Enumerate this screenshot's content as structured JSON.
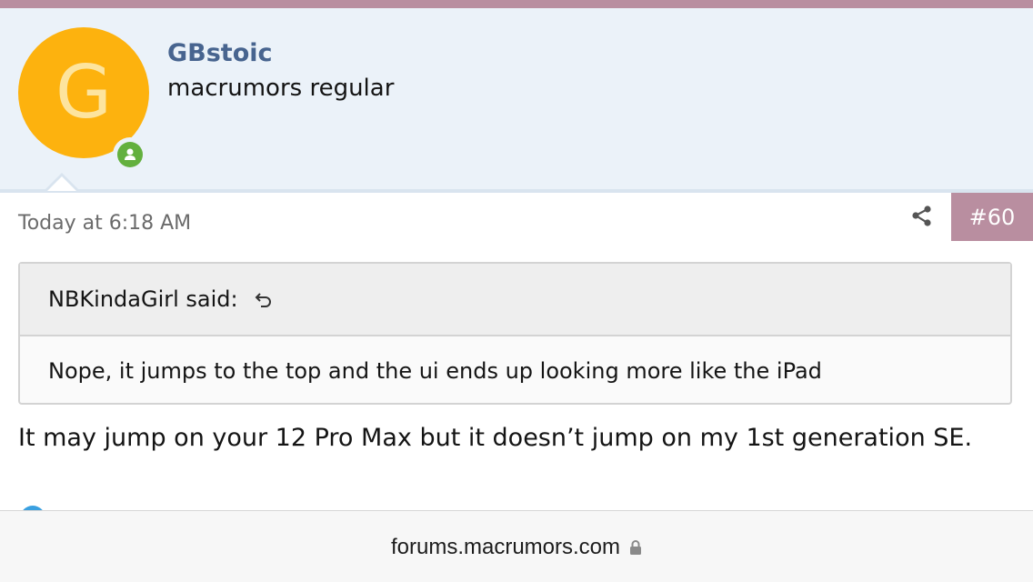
{
  "user": {
    "avatar_letter": "G",
    "name": "GBstoic",
    "title": "macrumors regular",
    "avatar_color": "#fdb20e",
    "online_color": "#63b03e"
  },
  "post": {
    "date": "Today at 6:18 AM",
    "number": "#60",
    "quote": {
      "author_line": "NBKindaGirl said:",
      "text": "Nope, it jumps to the top and the ui ends up looking more like the iPad"
    },
    "body": "It may jump on your 12 Pro Max but it doesn’t jump on my 1st generation SE."
  },
  "browser": {
    "url": "forums.macrumors.com"
  },
  "icons": {
    "online": "user-online-icon",
    "share": "share-icon",
    "quote_jump": "jump-to-quote-icon",
    "lock": "lock-icon"
  },
  "colors": {
    "accent": "#b98ea0",
    "header_bg": "#ebf2f9",
    "username": "#47648f"
  }
}
